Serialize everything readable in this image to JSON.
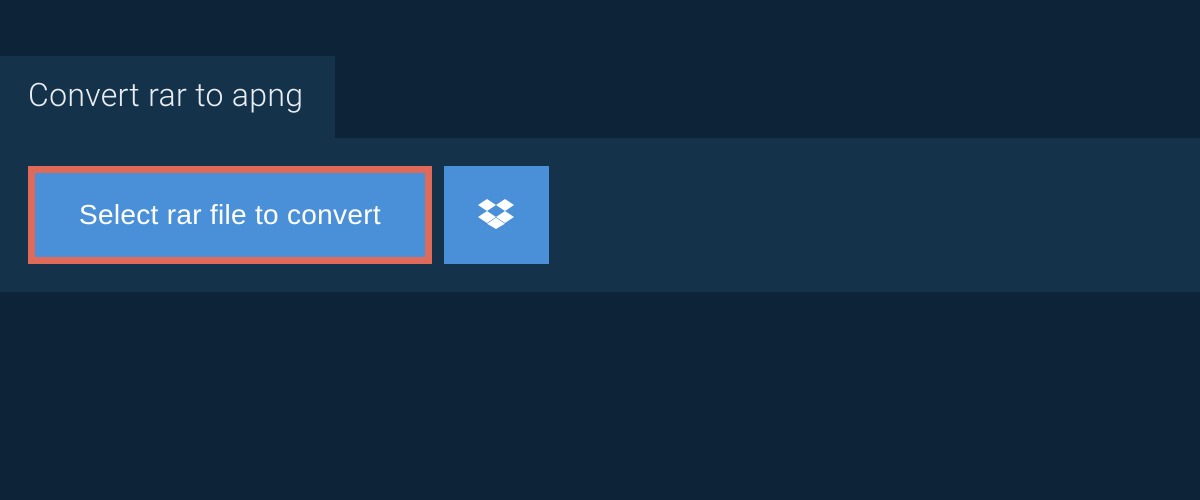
{
  "header": {
    "title": "Convert rar to apng"
  },
  "actions": {
    "select_label": "Select rar file to convert"
  }
}
